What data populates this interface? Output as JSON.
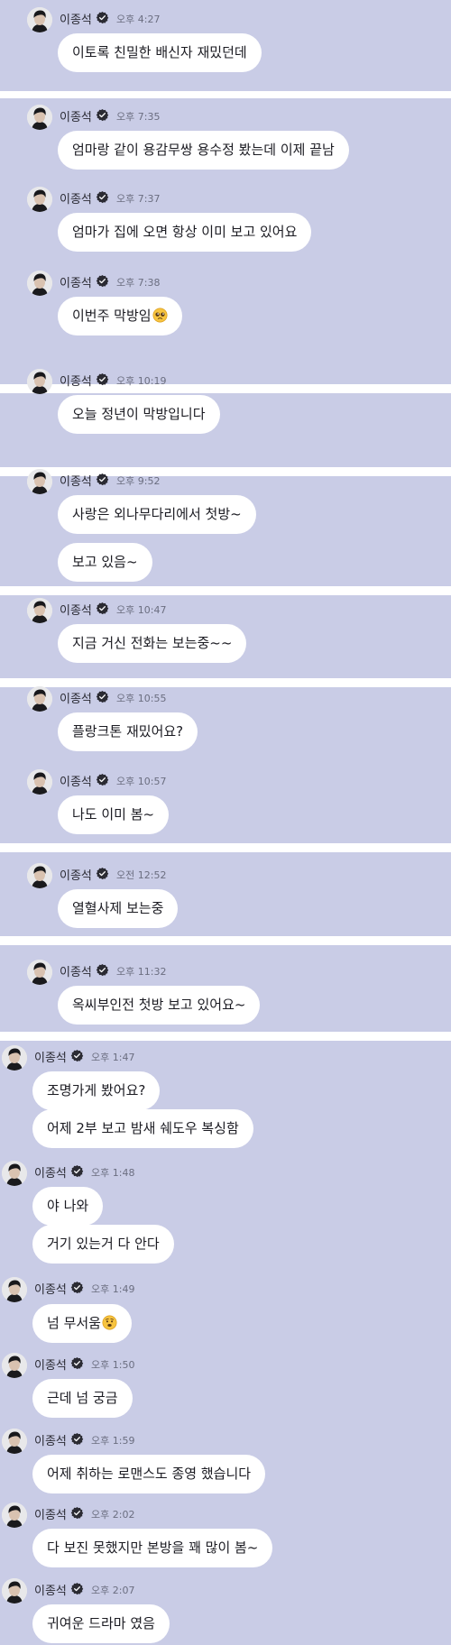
{
  "sender": "이종석",
  "avatar_icon": "profile-photo",
  "verified_icon": "verified-badge-icon",
  "panel_color": "#c9cce6",
  "messages": [
    {
      "time": "오후 4:27",
      "bubbles": [
        "이토록 친밀한 배신자 재밌던데"
      ]
    },
    {
      "time": "오후 7:35",
      "bubbles": [
        "엄마랑 같이 용감무쌍 용수정 봤는데 이제 끝남"
      ]
    },
    {
      "time": "오후 7:37",
      "bubbles": [
        "엄마가 집에 오면 항상 이미 보고 있어요"
      ]
    },
    {
      "time": "오후 7:38",
      "bubbles": [
        "이번주 막방임"
      ]
    },
    {
      "time": "오후 10:19",
      "bubbles": [
        "오늘 정년이 막방입니다"
      ]
    },
    {
      "time": "오후 9:52",
      "bubbles": [
        "사랑은 외나무다리에서 첫방~",
        "보고 있음~"
      ]
    },
    {
      "time": "오후 10:47",
      "bubbles": [
        "지금 거신 전화는 보는중~~"
      ]
    },
    {
      "time": "오후 10:55",
      "bubbles": [
        "플랑크톤 재밌어요?"
      ]
    },
    {
      "time": "오후 10:57",
      "bubbles": [
        "나도 이미 봄~"
      ]
    },
    {
      "time": "오전 12:52",
      "bubbles": [
        "열혈사제 보는중"
      ]
    },
    {
      "time": "오후 11:32",
      "bubbles": [
        "옥씨부인전 첫방 보고 있어요~"
      ]
    },
    {
      "time": "오후 1:47",
      "bubbles": [
        "조명가게 봤어요?",
        "어제 2부 보고 밤새 쉐도우 복싱함"
      ]
    },
    {
      "time": "오후 1:48",
      "bubbles": [
        "야 나와",
        "거기 있는거 다 안다"
      ]
    },
    {
      "time": "오후 1:49",
      "bubbles": [
        "넘 무서움"
      ]
    },
    {
      "time": "오후 1:50",
      "bubbles": [
        "근데 넘 궁금"
      ]
    },
    {
      "time": "오후 1:59",
      "bubbles": [
        "어제 취하는 로맨스도 종영 했습니다"
      ]
    },
    {
      "time": "오후 2:02",
      "bubbles": [
        "다 보진 못했지만 본방을 꽤 많이 봄~"
      ]
    },
    {
      "time": "오후 2:07",
      "bubbles": [
        "귀여운 드라마 였음"
      ]
    }
  ]
}
